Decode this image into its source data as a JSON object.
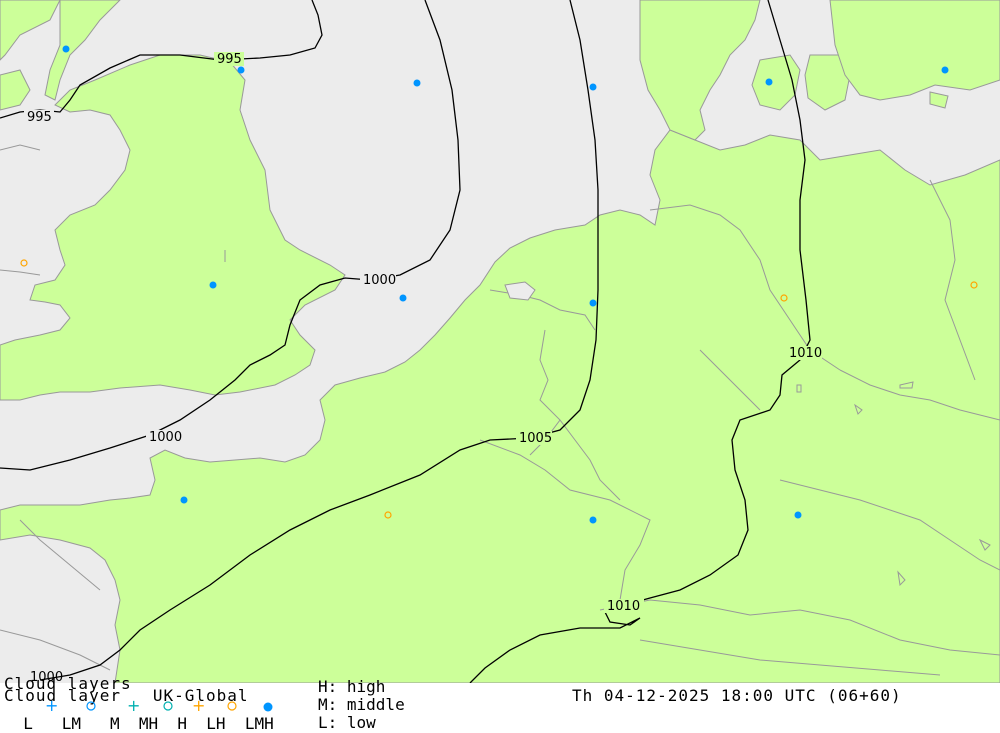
{
  "colors": {
    "sea": "#ececec",
    "land": "#ccff99",
    "border": "#999999",
    "isobar": "#000000",
    "symbol_low": "#0095ff",
    "symbol_middle": "#00b0b0",
    "symbol_high": "#ffa500"
  },
  "isobar_labels": [
    "995",
    "995",
    "1000",
    "1000",
    "1005",
    "1010",
    "1010",
    "1000"
  ],
  "legend": {
    "title": "Cloud layers",
    "subtitle": "Cloud layer   UK-Global",
    "row2": "  L   LM   M  MH  H  LH  LMH",
    "key_high": "H: high",
    "key_middle": "M: middle",
    "key_low": "L: low",
    "datetime": "Th 04-12-2025 18:00 UTC (06+60)"
  }
}
